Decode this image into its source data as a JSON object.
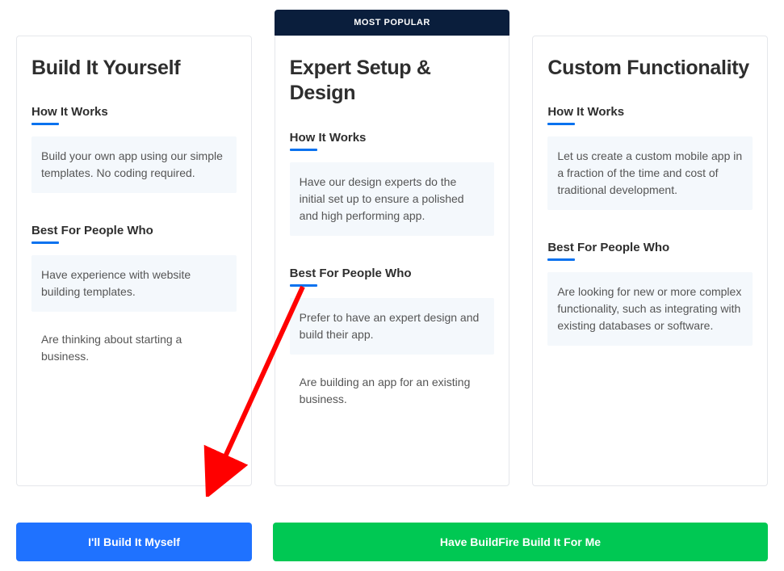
{
  "badges": {
    "most_popular": "MOST POPULAR"
  },
  "sections": {
    "how_it_works": "How It Works",
    "best_for": "Best For People Who"
  },
  "cards": [
    {
      "title": "Build It Yourself",
      "how": "Build your own app using our simple templates. No coding required.",
      "best1": "Have experience with website building templates.",
      "best2": "Are thinking about starting a business."
    },
    {
      "title": "Expert Setup & Design",
      "how": "Have our design experts do the initial set up to ensure a polished and high performing app.",
      "best1": "Prefer to have an expert design and build their app.",
      "best2": "Are building an app for an existing business."
    },
    {
      "title": "Custom Functionality",
      "how": "Let us create a custom mobile app in a fraction of the time and cost of traditional development.",
      "best1": "Are looking for new or more complex functionality, such as integrating with existing databases or software.",
      "best2": ""
    }
  ],
  "buttons": {
    "build_myself": "I'll Build It Myself",
    "build_for_me": "Have BuildFire Build It For Me"
  },
  "colors": {
    "badge_bg": "#0a1e3c",
    "accent_blue": "#0a72ef",
    "button_blue": "#1f72ff",
    "button_green": "#00c853",
    "arrow_red": "#ff0000"
  }
}
